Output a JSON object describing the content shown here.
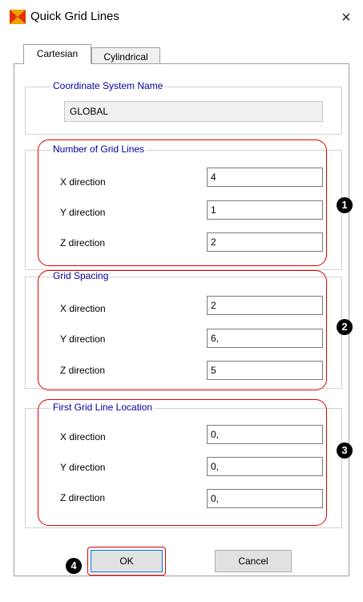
{
  "window": {
    "title": "Quick Grid Lines",
    "close_glyph": "×",
    "app_icon": "grid-app-icon"
  },
  "tabs": [
    {
      "label": "Cartesian",
      "active": true
    },
    {
      "label": "Cylindrical",
      "active": false
    }
  ],
  "coordinate_system": {
    "title": "Coordinate System Name",
    "value": "GLOBAL"
  },
  "groups": [
    {
      "title": "Number of Grid Lines",
      "badge": "1",
      "rows": [
        {
          "label": "X direction",
          "value": "4"
        },
        {
          "label": "Y direction",
          "value": "1"
        },
        {
          "label": "Z direction",
          "value": "2"
        }
      ]
    },
    {
      "title": "Grid Spacing",
      "badge": "2",
      "rows": [
        {
          "label": "X direction",
          "value": "2"
        },
        {
          "label": "Y direction",
          "value": "6,"
        },
        {
          "label": "Z direction",
          "value": "5"
        }
      ]
    },
    {
      "title": "First Grid Line Location",
      "badge": "3",
      "rows": [
        {
          "label": "X direction",
          "value": "0,"
        },
        {
          "label": "Y direction",
          "value": "0,"
        },
        {
          "label": "Z direction",
          "value": "0,"
        }
      ]
    }
  ],
  "buttons": {
    "ok_label": "OK",
    "cancel_label": "Cancel",
    "ok_badge": "4"
  },
  "colors": {
    "highlight_outline": "#e00000",
    "group_title": "#0000a0",
    "badge_bg": "#000000"
  }
}
